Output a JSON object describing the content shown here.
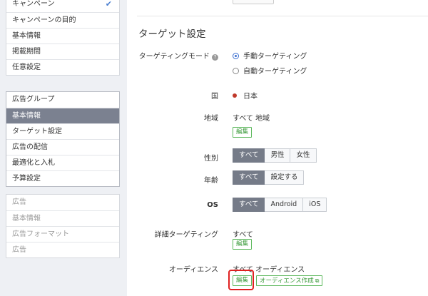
{
  "sidebar": {
    "campaign": {
      "items": [
        {
          "label": "キャンペーン",
          "checked": true
        },
        {
          "label": "キャンペーンの目的"
        },
        {
          "label": "基本情報"
        },
        {
          "label": "掲載期間"
        },
        {
          "label": "任意設定"
        }
      ]
    },
    "adgroup": {
      "items": [
        {
          "label": "広告グループ"
        },
        {
          "label": "基本情報",
          "active": true
        },
        {
          "label": "ターゲット設定"
        },
        {
          "label": "広告の配信"
        },
        {
          "label": "最適化と入札"
        },
        {
          "label": "予算設定"
        }
      ]
    },
    "ad": {
      "items": [
        {
          "label": "広告"
        },
        {
          "label": "基本情報"
        },
        {
          "label": "広告フォーマット"
        },
        {
          "label": "広告"
        }
      ]
    }
  },
  "main": {
    "section_title": "ターゲット設定",
    "targeting_mode": {
      "label": "ターゲティングモード",
      "help": "?",
      "options": [
        "手動ターゲティング",
        "自動ターゲティング"
      ],
      "selected": "手動ターゲティング"
    },
    "country": {
      "label": "国",
      "value": "日本"
    },
    "region": {
      "label": "地域",
      "value": "すべて 地域",
      "edit": "編集"
    },
    "gender": {
      "label": "性別",
      "options": [
        "すべて",
        "男性",
        "女性"
      ],
      "selected": "すべて"
    },
    "age": {
      "label": "年齢",
      "options": [
        "すべて",
        "設定する"
      ],
      "selected": "すべて"
    },
    "os": {
      "label": "OS",
      "options": [
        "すべて",
        "Android",
        "iOS"
      ],
      "selected": "すべて"
    },
    "detailed": {
      "label": "詳細ターゲティング",
      "value": "すべて",
      "edit": "編集"
    },
    "audience": {
      "label": "オーディエンス",
      "value": "すべて オーディエンス",
      "edit": "編集",
      "create": "オーディエンス作成"
    }
  },
  "colors": {
    "selected_segment": "#757b88",
    "edit_green": "#5cb85c",
    "highlight_red": "#e02020",
    "radio_blue": "#3b6fd1"
  }
}
